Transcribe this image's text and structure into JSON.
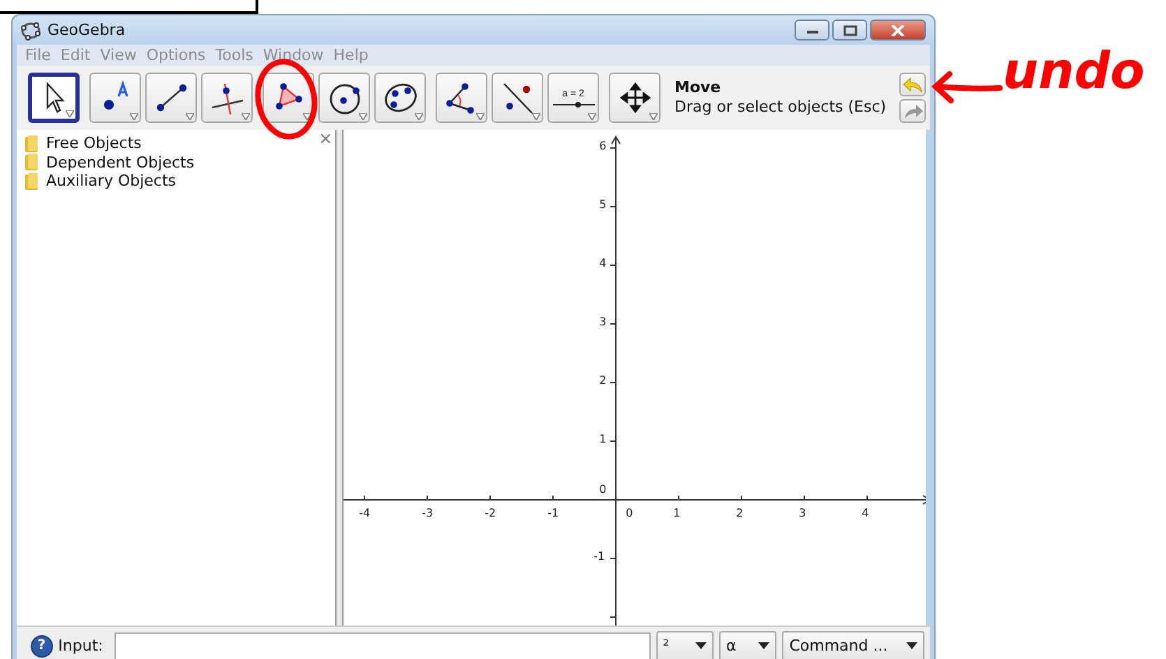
{
  "window": {
    "title": "GeoGebra"
  },
  "menu": [
    "File",
    "Edit",
    "View",
    "Options",
    "Tools",
    "Window",
    "Help"
  ],
  "toolbar": {
    "tool_groups": [
      [
        {
          "kind": "move",
          "selected": true
        }
      ],
      [
        {
          "kind": "point",
          "selected": false
        },
        {
          "kind": "segment",
          "selected": false
        },
        {
          "kind": "perpendicular",
          "selected": false
        }
      ],
      [
        {
          "kind": "polygon",
          "selected": false
        },
        {
          "kind": "circle",
          "selected": false
        },
        {
          "kind": "conic",
          "selected": false
        }
      ],
      [
        {
          "kind": "angle",
          "selected": false
        },
        {
          "kind": "reflect",
          "selected": false
        },
        {
          "kind": "slider",
          "selected": false,
          "label": "a = 2"
        }
      ],
      [
        {
          "kind": "move-view",
          "selected": false
        }
      ]
    ],
    "tool_name": "Move",
    "tool_help": "Drag or select objects (Esc)"
  },
  "algebra": {
    "close": "×",
    "folders": [
      "Free Objects",
      "Dependent Objects",
      "Auxiliary Objects"
    ]
  },
  "graphics": {
    "x_labels": [
      "-4",
      "-3",
      "-2",
      "-1",
      "0",
      "1",
      "2",
      "3",
      "4"
    ],
    "y_labels": [
      "6",
      "5",
      "4",
      "3",
      "2",
      "1",
      "0",
      "-1"
    ]
  },
  "input_bar": {
    "help": "?",
    "label": "Input:",
    "symbol_menus": [
      "²",
      "α"
    ],
    "command_menu": "Command ..."
  },
  "annotations": {
    "note": "undo"
  }
}
